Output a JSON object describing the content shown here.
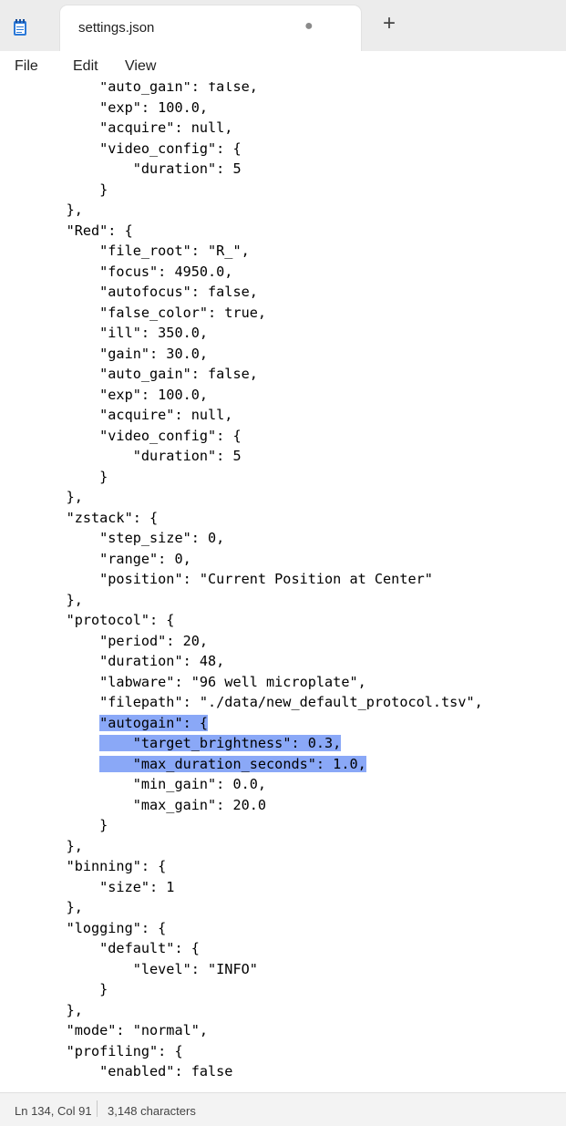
{
  "window": {
    "tab_title": "settings.json",
    "tab_dot": "●",
    "new_tab": "+"
  },
  "menu": {
    "file": "File",
    "edit": "Edit",
    "view": "View"
  },
  "editor": {
    "lines": [
      "        \"auto_gain\": false,",
      "        \"exp\": 100.0,",
      "        \"acquire\": null,",
      "        \"video_config\": {",
      "            \"duration\": 5",
      "        }",
      "    },",
      "    \"Red\": {",
      "        \"file_root\": \"R_\",",
      "        \"focus\": 4950.0,",
      "        \"autofocus\": false,",
      "        \"false_color\": true,",
      "        \"ill\": 350.0,",
      "        \"gain\": 30.0,",
      "        \"auto_gain\": false,",
      "        \"exp\": 100.0,",
      "        \"acquire\": null,",
      "        \"video_config\": {",
      "            \"duration\": 5",
      "        }",
      "    },",
      "    \"zstack\": {",
      "        \"step_size\": 0,",
      "        \"range\": 0,",
      "        \"position\": \"Current Position at Center\"",
      "    },",
      "    \"protocol\": {",
      "        \"period\": 20,",
      "        \"duration\": 48,",
      "        \"labware\": \"96 well microplate\",",
      "        \"filepath\": \"./data/new_default_protocol.tsv\",",
      "        \"autogain\": {",
      "            \"target_brightness\": 0.3,",
      "            \"max_duration_seconds\": 1.0,",
      "            \"min_gain\": 0.0,",
      "            \"max_gain\": 20.0",
      "        }",
      "    },",
      "    \"binning\": {",
      "        \"size\": 1",
      "    },",
      "    \"logging\": {",
      "        \"default\": {",
      "            \"level\": \"INFO\"",
      "        }",
      "    },",
      "    \"mode\": \"normal\",",
      "    \"profiling\": {",
      "        \"enabled\": false"
    ],
    "selected_line_numbers": [
      31,
      32,
      33
    ],
    "selection_color": "#8aa8f7"
  },
  "status": {
    "position": "Ln 134, Col 91",
    "characters": "3,148 characters"
  }
}
